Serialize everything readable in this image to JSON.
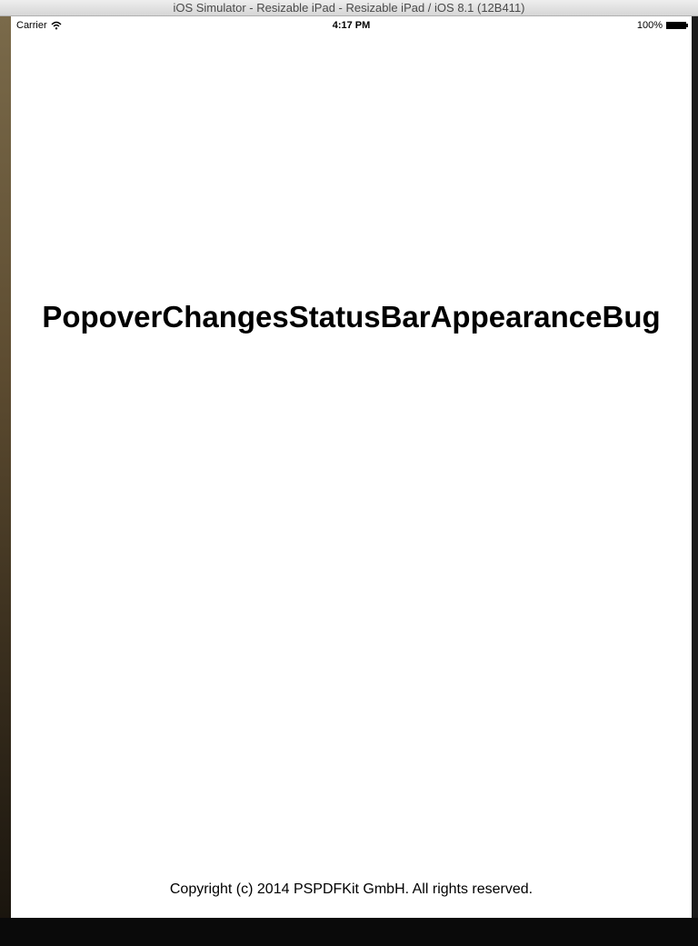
{
  "window": {
    "title": "iOS Simulator - Resizable iPad - Resizable iPad / iOS 8.1 (12B411)"
  },
  "statusbar": {
    "carrier": "Carrier",
    "wifi_icon": "wifi-icon",
    "time": "4:17 PM",
    "battery_percent": "100%",
    "battery_level": 1.0,
    "battery_icon": "battery-full-icon"
  },
  "main": {
    "title": "PopoverChangesStatusBarAppearanceBug"
  },
  "footer": {
    "copyright": "Copyright (c) 2014 PSPDFKit GmbH. All rights reserved."
  }
}
